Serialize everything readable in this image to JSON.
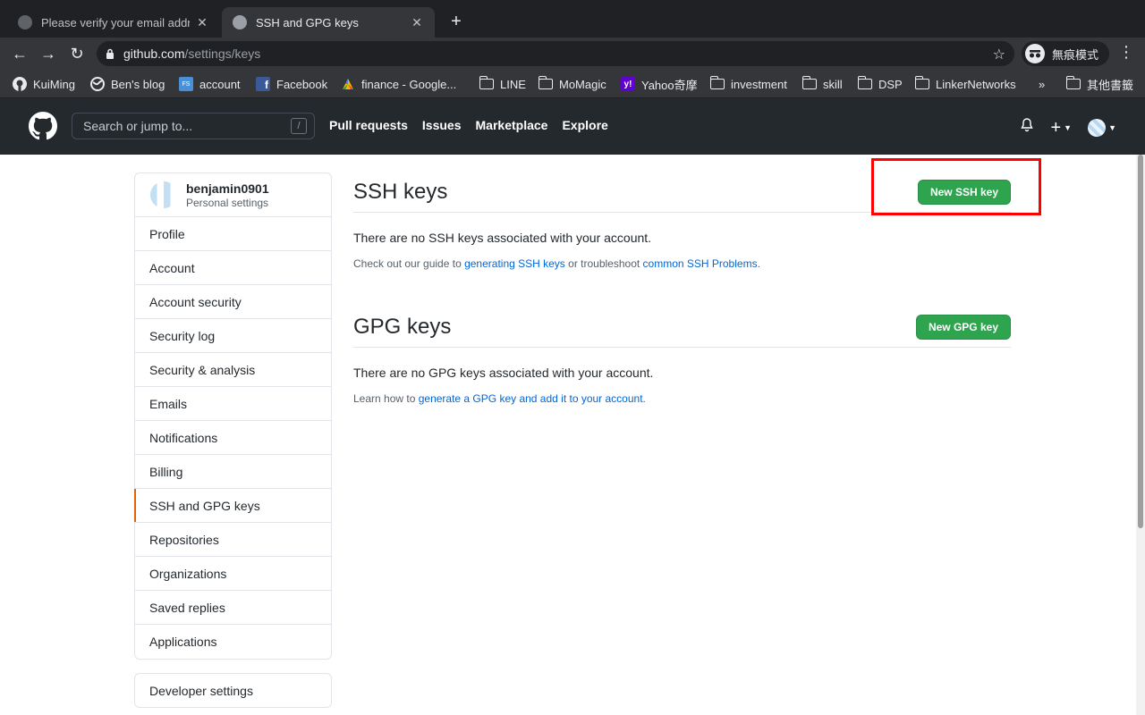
{
  "browser": {
    "tabs": [
      {
        "title": "Please verify your email address"
      },
      {
        "title": "SSH and GPG keys"
      }
    ],
    "address": {
      "domain": "github.com",
      "path": "/settings/keys"
    },
    "incognito_label": "無痕模式",
    "bookmarks": [
      {
        "label": "KuiMing",
        "icon": "github-icon"
      },
      {
        "label": "Ben's blog",
        "icon": "globe-icon"
      },
      {
        "label": "account",
        "icon": "fs-icon"
      },
      {
        "label": "Facebook",
        "icon": "facebook-icon"
      },
      {
        "label": "finance - Google...",
        "icon": "sheets-icon"
      },
      {
        "label": "LINE",
        "icon": "folder-icon"
      },
      {
        "label": "MoMagic",
        "icon": "folder-icon"
      },
      {
        "label": "Yahoo奇摩",
        "icon": "yahoo-icon"
      },
      {
        "label": "investment",
        "icon": "folder-icon"
      },
      {
        "label": "skill",
        "icon": "folder-icon"
      },
      {
        "label": "DSP",
        "icon": "folder-icon"
      },
      {
        "label": "LinkerNetworks",
        "icon": "folder-icon"
      }
    ],
    "bookmarks_overflow": "»",
    "other_bookmarks": "其他書籤"
  },
  "github": {
    "search_placeholder": "Search or jump to...",
    "search_shortcut": "/",
    "nav": [
      "Pull requests",
      "Issues",
      "Marketplace",
      "Explore"
    ]
  },
  "sidebar": {
    "username": "benjamin0901",
    "subtitle": "Personal settings",
    "items": [
      "Profile",
      "Account",
      "Account security",
      "Security log",
      "Security & analysis",
      "Emails",
      "Notifications",
      "Billing",
      "SSH and GPG keys",
      "Repositories",
      "Organizations",
      "Saved replies",
      "Applications"
    ],
    "active_index": 8,
    "developer_settings": "Developer settings"
  },
  "ssh": {
    "title": "SSH keys",
    "button": "New SSH key",
    "message": "There are no SSH keys associated with your account.",
    "hint_prefix": "Check out our guide to ",
    "hint_link1": "generating SSH keys",
    "hint_middle": " or troubleshoot ",
    "hint_link2": "common SSH Problems",
    "hint_suffix": "."
  },
  "gpg": {
    "title": "GPG keys",
    "button": "New GPG key",
    "message": "There are no GPG keys associated with your account.",
    "hint_prefix": "Learn how to ",
    "hint_link": "generate a GPG key and add it to your account",
    "hint_suffix": "."
  },
  "colors": {
    "accent": "#2ea44f",
    "link": "#0366d6",
    "highlight": "#ff0000",
    "active_marker": "#e36209"
  }
}
